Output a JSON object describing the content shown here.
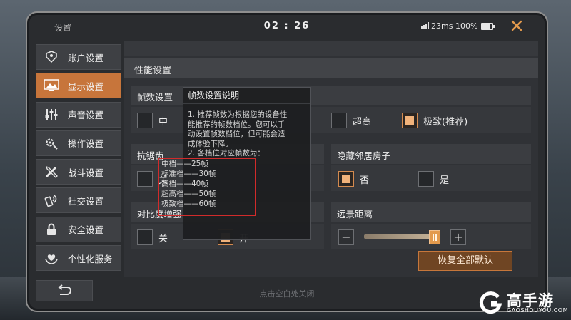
{
  "status": {
    "title": "设置",
    "time": "02 : 26",
    "ping": "23ms",
    "battery": "100%"
  },
  "sidebar": {
    "items": [
      {
        "label": "账户设置",
        "icon": "account-icon"
      },
      {
        "label": "显示设置",
        "icon": "display-icon",
        "active": true
      },
      {
        "label": "声音设置",
        "icon": "sound-icon"
      },
      {
        "label": "操作设置",
        "icon": "controls-icon"
      },
      {
        "label": "战斗设置",
        "icon": "combat-icon"
      },
      {
        "label": "社交设置",
        "icon": "social-icon"
      },
      {
        "label": "安全设置",
        "icon": "security-icon"
      },
      {
        "label": "个性化服务",
        "icon": "personalization-icon"
      }
    ]
  },
  "panel": {
    "title": "性能设置",
    "framerate": {
      "label": "帧数设置",
      "options": [
        "中",
        "超高",
        "极致(推荐)"
      ],
      "selected": "极致(推荐)"
    },
    "antialias": {
      "label": "抗锯齿",
      "options": [
        "关"
      ]
    },
    "hide_neighbor": {
      "label": "隐藏邻居房子",
      "options": [
        "否",
        "是"
      ],
      "selected": "否"
    },
    "contrast": {
      "label": "对比度增强",
      "options": [
        "关",
        "开"
      ],
      "selected": "开"
    },
    "view_distance": {
      "label": "远景距离",
      "value": 0.95
    },
    "reset_label": "恢复全部默认"
  },
  "tooltip": {
    "title": "帧数设置说明",
    "lines": [
      "1. 推荐帧数为根据您的设备性",
      "能推荐的帧数档位。您可以手",
      "动设置帧数档位，但可能会造",
      "成体验下降。",
      "2. 各档位对应帧数为："
    ],
    "fps": [
      "中档——25帧",
      "标准档——30帧",
      "高档——40帧",
      "超高档——50帧",
      "极致档——60帧"
    ]
  },
  "hint": "点击空白处关闭",
  "watermark": {
    "name": "高手游",
    "site": "GAOSHOUYOU.COM"
  },
  "colors": {
    "accent": "#c7753b",
    "highlight": "#d12b2b"
  }
}
